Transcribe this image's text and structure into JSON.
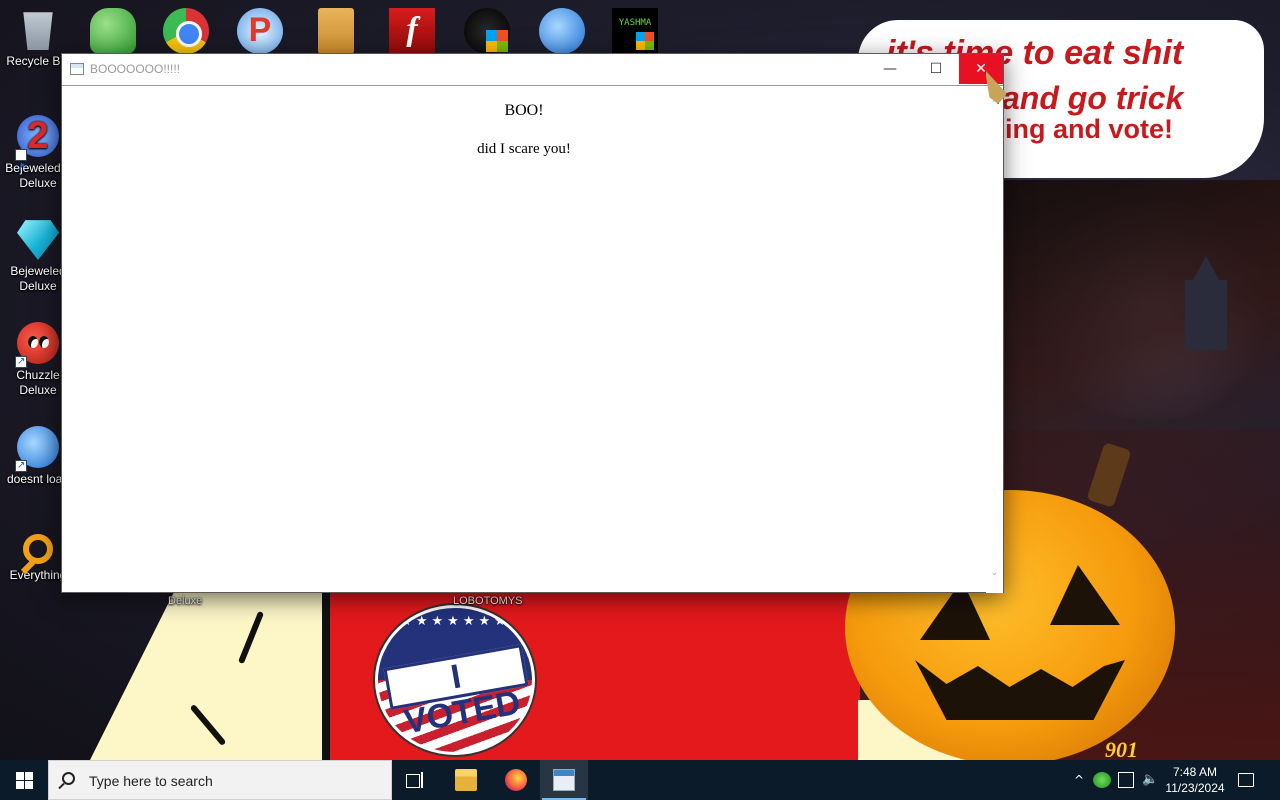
{
  "desktop": {
    "left_icons": [
      {
        "label": "Recycle Bin",
        "icon": "recycle-bin-icon"
      },
      {
        "label": "Bejeweled 2 Deluxe",
        "icon": "bejeweled-2-icon"
      },
      {
        "label": "Bejeweled Deluxe",
        "icon": "bejeweled-gem-icon"
      },
      {
        "label": "Chuzzle Deluxe",
        "icon": "chuzzle-icon"
      },
      {
        "label": "doesnt load",
        "icon": "thunderbird-icon"
      },
      {
        "label": "Everything",
        "icon": "everything-search-icon"
      }
    ],
    "top_icons": [
      {
        "icon": "msn-messenger-icon"
      },
      {
        "icon": "chrome-icon"
      },
      {
        "icon": "p-game-icon"
      },
      {
        "icon": "folder-icon"
      },
      {
        "icon": "flash-player-icon"
      },
      {
        "icon": "shield-admin-icon"
      },
      {
        "icon": "thunderbird-icon"
      },
      {
        "icon": "yashma-icon",
        "label": "YASHMA"
      }
    ],
    "under_window_labels": {
      "left": "Deluxe",
      "middle": "LOBOTOMYS"
    }
  },
  "wallpaper": {
    "speech_bubble": {
      "line1": "it's time to eat shit",
      "line2": "and go trick",
      "line3": "ing and vote!"
    },
    "sticker_text": "I VOTED",
    "stars": "★★★★★★★",
    "pumpkin_tag": "901"
  },
  "window": {
    "title": "BOOOOOOO!!!!!",
    "controls": {
      "minimize": "—",
      "maximize": "☐",
      "close": "✕"
    },
    "heading": "BOO!",
    "message": "did I scare you!",
    "scroll_up": "⌃",
    "scroll_down": "⌄"
  },
  "taskbar": {
    "search_placeholder": "Type here to search",
    "apps": [
      {
        "name": "File Explorer",
        "icon": "file-explorer-icon"
      },
      {
        "name": "Firefox",
        "icon": "firefox-icon"
      },
      {
        "name": "BOOOOOOO!!!!!",
        "icon": "app-window-icon",
        "active": true
      }
    ],
    "tray": {
      "chevron": "^",
      "volume": "🔈",
      "time": "7:48 AM",
      "date": "11/23/2024"
    }
  },
  "colors": {
    "close_button": "#e81123",
    "taskbar_bg": "#0b1b2a",
    "speech_text": "#c8191c"
  }
}
